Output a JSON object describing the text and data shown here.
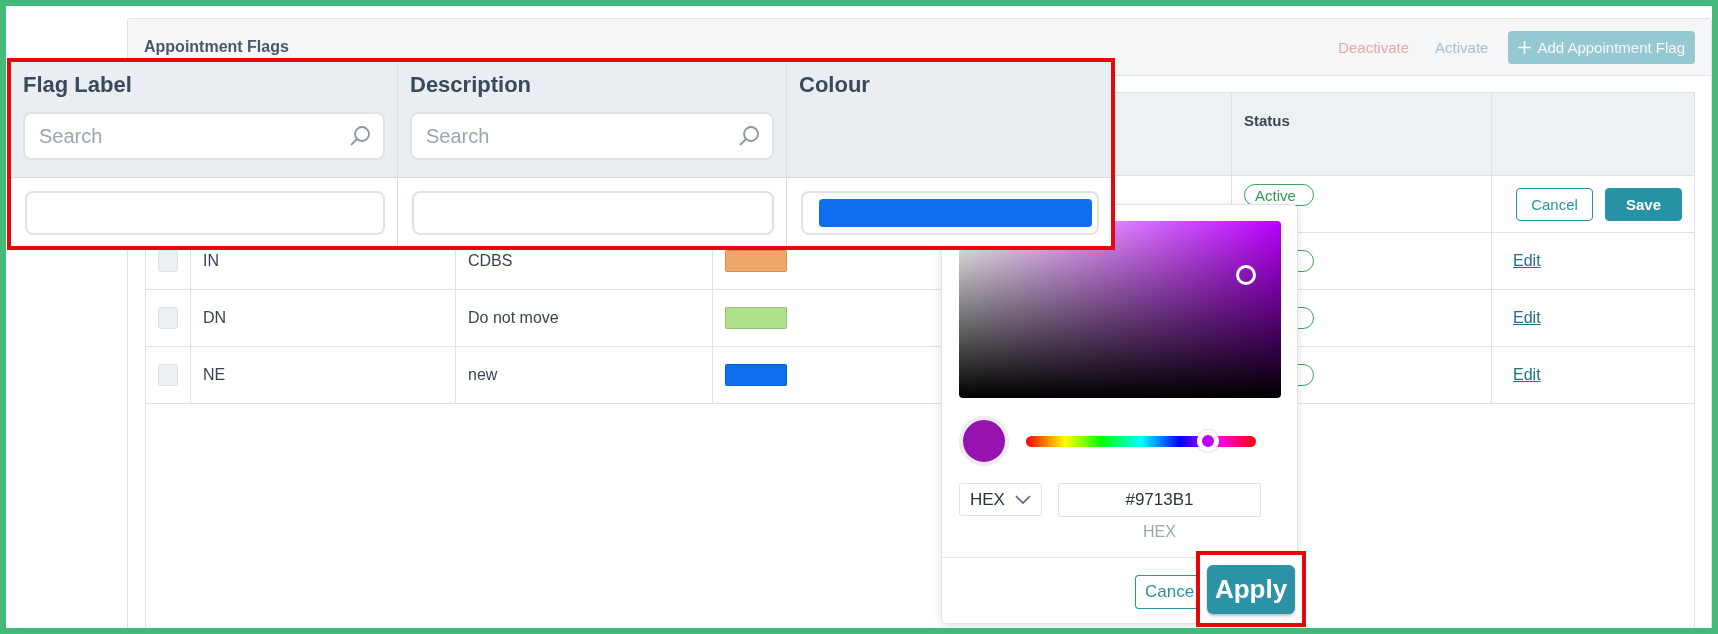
{
  "card": {
    "title": "Appointment Flags",
    "actions": [
      {
        "label": "Deactivate",
        "kind": "danger",
        "disabled": true
      },
      {
        "label": "Activate",
        "kind": "info",
        "disabled": true
      },
      {
        "label": "Add Appointment Flag",
        "kind": "primary",
        "disabled": true
      }
    ]
  },
  "table": {
    "status_header": "Status",
    "rows": [
      {
        "kind": "editing",
        "status": "Active",
        "buttons": [
          {
            "label": "Cancel",
            "kind": "secondary"
          },
          {
            "label": "Save",
            "kind": "primary"
          }
        ]
      },
      {
        "kind": "view",
        "checked": false,
        "flag": "IN",
        "description": "CDBS",
        "color": "#f0a868",
        "link": "Edit"
      },
      {
        "kind": "view",
        "checked": false,
        "flag": "DN",
        "description": "Do not move",
        "color": "#b0e08a",
        "link": "Edit"
      },
      {
        "kind": "view",
        "checked": false,
        "flag": "NE",
        "description": "new",
        "color": "#0d6fed",
        "link": "Edit"
      }
    ]
  },
  "callout": {
    "columns": [
      {
        "label": "Flag Label",
        "kind": "text",
        "placeholder": "Search"
      },
      {
        "label": "Description",
        "kind": "text",
        "placeholder": "Search"
      },
      {
        "label": "Colour",
        "kind": "color",
        "color": "#0d6fed"
      }
    ]
  },
  "color_picker": {
    "color": "#9713b1",
    "hue": {
      "level": 0.79
    },
    "format": "HEX",
    "value": "#9713B1",
    "value_label": "HEX",
    "buttons": [
      {
        "label": "Cance",
        "kind": "secondary",
        "highlighted": false
      },
      {
        "label": "Apply",
        "kind": "primary",
        "highlighted": true
      }
    ]
  }
}
